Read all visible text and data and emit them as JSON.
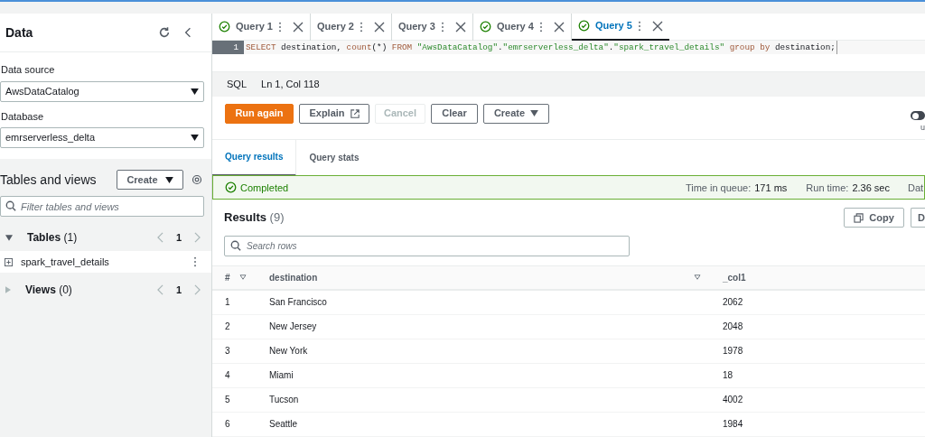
{
  "sidebar": {
    "title": "Data",
    "data_source": {
      "label": "Data source",
      "value": "AwsDataCatalog"
    },
    "database": {
      "label": "Database",
      "value": "emrserverless_delta"
    },
    "tables_and_views": {
      "title": "Tables and views",
      "create_button": "Create",
      "filter": {
        "placeholder": "Filter tables and views"
      },
      "sections": [
        {
          "label": "Tables",
          "count": "(1)",
          "page": "1",
          "expanded": true,
          "items": [
            "spark_travel_details"
          ]
        },
        {
          "label": "Views",
          "count": "(0)",
          "page": "1",
          "expanded": false
        }
      ]
    }
  },
  "query_tabs": [
    {
      "label": "Query 1",
      "completed": true,
      "selected": false
    },
    {
      "label": "Query 2",
      "completed": false,
      "selected": false
    },
    {
      "label": "Query 3",
      "completed": false,
      "selected": false
    },
    {
      "label": "Query 4",
      "completed": true,
      "selected": false
    },
    {
      "label": "Query 5",
      "completed": true,
      "selected": true
    }
  ],
  "editor": {
    "line_number": "1",
    "tokens": [
      {
        "kind": "keyword",
        "text": "SELECT"
      },
      {
        "kind": "plain",
        "text": " destination, "
      },
      {
        "kind": "keyword",
        "text": "count"
      },
      {
        "kind": "plain",
        "text": "(*) "
      },
      {
        "kind": "keyword",
        "text": "FROM"
      },
      {
        "kind": "string",
        "text": " \"AwsDataCatalog\""
      },
      {
        "kind": "plain",
        "text": "."
      },
      {
        "kind": "string",
        "text": "\"emrserverless_delta\""
      },
      {
        "kind": "plain",
        "text": "."
      },
      {
        "kind": "string",
        "text": "\"spark_travel_details\""
      },
      {
        "kind": "keyword",
        "text": " group by"
      },
      {
        "kind": "plain",
        "text": " destination;"
      }
    ]
  },
  "status_bar": {
    "language": "SQL",
    "position": "Ln 1, Col 118"
  },
  "actions": [
    {
      "label": "Run again",
      "kind": "primary",
      "disabled": false
    },
    {
      "label": "Explain",
      "kind": "external",
      "disabled": false
    },
    {
      "label": "Cancel",
      "kind": "normal",
      "disabled": true
    },
    {
      "label": "Clear",
      "kind": "normal",
      "disabled": false
    },
    {
      "label": "Create",
      "kind": "dropdown",
      "disabled": false
    }
  ],
  "toggle": {
    "on": false,
    "label": "u"
  },
  "result_tabs": [
    {
      "label": "Query results",
      "selected": true
    },
    {
      "label": "Query stats",
      "selected": false
    }
  ],
  "status": {
    "text": "Completed",
    "time_in_queue_label": "Time in queue:",
    "time_in_queue": "171 ms",
    "run_time_label": "Run time:",
    "run_time": "2.36 sec",
    "cut_label": "Dat"
  },
  "results": {
    "title": "Results",
    "count": "(9)",
    "copy_button": "Copy",
    "cut_button": "D",
    "search": {
      "placeholder": "Search rows"
    },
    "columns": [
      "#",
      "destination",
      "_col1"
    ],
    "rows": [
      [
        "1",
        "San Francisco",
        "2062"
      ],
      [
        "2",
        "New Jersey",
        "2048"
      ],
      [
        "3",
        "New York",
        "1978"
      ],
      [
        "4",
        "Miami",
        "18"
      ],
      [
        "5",
        "Tucson",
        "4002"
      ],
      [
        "6",
        "Seattle",
        "1984"
      ]
    ]
  }
}
